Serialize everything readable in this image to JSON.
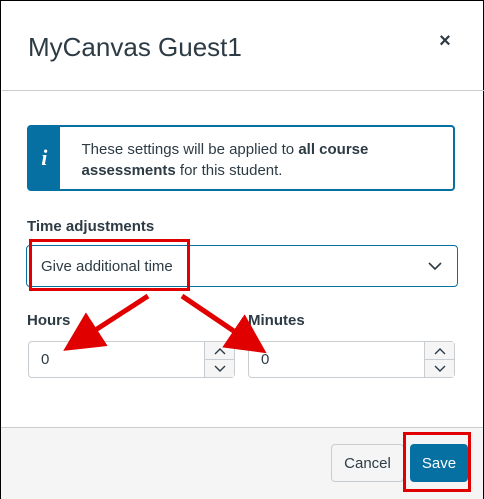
{
  "dialog": {
    "title": "MyCanvas Guest1",
    "close_icon": "close-icon",
    "close_glyph": "×"
  },
  "info": {
    "icon": "info-icon",
    "icon_glyph": "i",
    "text_part1": "These settings will be applied to ",
    "text_bold1": "all course assessments",
    "text_part2": " for this student."
  },
  "time_adjustments": {
    "label": "Time adjustments",
    "selected": "Give additional time",
    "chevron_icon": "chevron-down-icon"
  },
  "hours": {
    "label": "Hours",
    "value": "0"
  },
  "minutes": {
    "label": "Minutes",
    "value": "0"
  },
  "footer": {
    "cancel_label": "Cancel",
    "save_label": "Save"
  },
  "colors": {
    "accent": "#0770a3",
    "annotation": "#e00000",
    "text": "#2d3b45"
  }
}
